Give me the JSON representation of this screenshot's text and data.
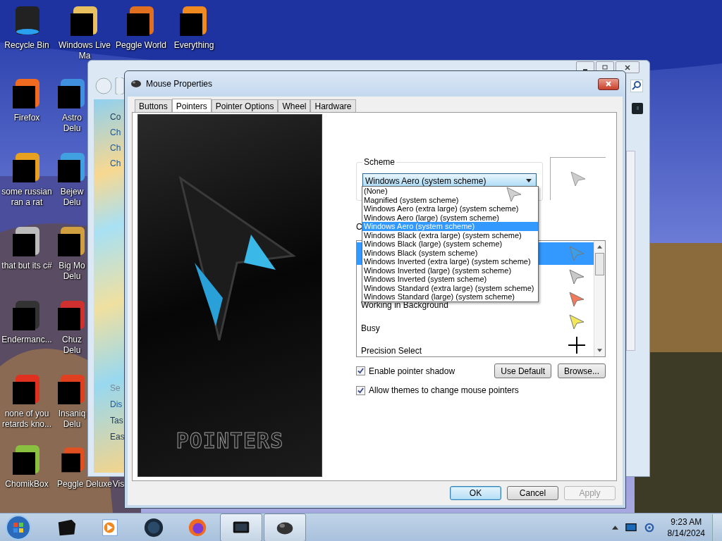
{
  "desktop_icons": [
    {
      "label": "Recycle Bin",
      "redacted": false
    },
    {
      "label": "Windows Live Ma",
      "redacted": true
    },
    {
      "label": "Peggle World",
      "redacted": true
    },
    {
      "label": "Everything",
      "redacted": true
    },
    {
      "label": "Firefox",
      "redacted": true
    },
    {
      "label": "Astro Delu",
      "redacted": true
    },
    {
      "label": "some russian ran a rat",
      "redacted": true
    },
    {
      "label": "Bejew Delu",
      "redacted": true
    },
    {
      "label": "that but its c#",
      "redacted": true
    },
    {
      "label": "Big Mo Delu",
      "redacted": true
    },
    {
      "label": "Endermanc...",
      "redacted": true
    },
    {
      "label": "Chuz Delu",
      "redacted": true
    },
    {
      "label": "none of you retards kno...",
      "redacted": true
    },
    {
      "label": "Insaniq Delu",
      "redacted": true
    },
    {
      "label": "ChomikBox",
      "redacted": true
    },
    {
      "label": "Peggle Deluxe",
      "redacted": true
    },
    {
      "label": "Vis"
    }
  ],
  "background_window": {
    "nav_links": [
      {
        "label": "Co",
        "kind": "heading"
      },
      {
        "label": "Ch",
        "kind": "link"
      },
      {
        "label": "Ch",
        "kind": "link"
      },
      {
        "label": "Ch",
        "kind": "link"
      }
    ],
    "see_also": {
      "title": "Se",
      "links": [
        "Dis",
        "Tas",
        "Eas"
      ]
    }
  },
  "dialog": {
    "title": "Mouse Properties",
    "tabs": [
      {
        "label": "Buttons",
        "selected": false
      },
      {
        "label": "Pointers",
        "selected": true
      },
      {
        "label": "Pointer Options",
        "selected": false
      },
      {
        "label": "Wheel",
        "selected": false
      },
      {
        "label": "Hardware",
        "selected": false
      }
    ],
    "preview_art": {
      "label": "POINTERS"
    },
    "scheme": {
      "label": "Scheme",
      "value": "Windows Aero (system scheme)",
      "expanded": true,
      "options": [
        {
          "label": "(None)",
          "selected": false
        },
        {
          "label": "Magnified (system scheme)",
          "selected": false
        },
        {
          "label": "Windows Aero (extra large) (system scheme)",
          "selected": false
        },
        {
          "label": "Windows Aero (large) (system scheme)",
          "selected": false
        },
        {
          "label": "Windows Aero (system scheme)",
          "selected": true
        },
        {
          "label": "Windows Black (extra large) (system scheme)",
          "selected": false
        },
        {
          "label": "Windows Black (large) (system scheme)",
          "selected": false
        },
        {
          "label": "Windows Black (system scheme)",
          "selected": false
        },
        {
          "label": "Windows Inverted (extra large) (system scheme)",
          "selected": false
        },
        {
          "label": "Windows Inverted (large) (system scheme)",
          "selected": false
        },
        {
          "label": "Windows Inverted (system scheme)",
          "selected": false
        },
        {
          "label": "Windows Standard (extra large) (system scheme)",
          "selected": false
        },
        {
          "label": "Windows Standard (large) (system scheme)",
          "selected": false
        }
      ]
    },
    "customize_label": "C",
    "pointers": [
      {
        "kind": "arrow",
        "color": "#3d9ee8",
        "selected": true
      },
      {
        "kind": "arrow",
        "color": "#c8c8c8",
        "selected": false
      },
      {
        "label": "Working in Background",
        "kind": "arrow",
        "color": "#f07a5a",
        "selected": false
      },
      {
        "label": "Busy",
        "kind": "arrow",
        "color": "#f2e65a",
        "selected": false
      },
      {
        "label": "Precision Select",
        "kind": "crosshair",
        "color": "#000000",
        "selected": false
      }
    ],
    "checkboxes": [
      {
        "label": "Enable pointer shadow",
        "checked": true
      },
      {
        "label": "Allow themes to change mouse pointers",
        "checked": true
      }
    ],
    "side_buttons": [
      "Use Default",
      "Browse..."
    ],
    "buttons": [
      {
        "label": "OK",
        "kind": "default",
        "disabled": false
      },
      {
        "label": "Cancel",
        "kind": "normal",
        "disabled": false
      },
      {
        "label": "Apply",
        "kind": "normal",
        "disabled": true
      }
    ]
  },
  "taskbar": {
    "items": [
      {
        "kind": "box",
        "selected": false
      },
      {
        "kind": "media",
        "selected": false
      },
      {
        "kind": "globe",
        "selected": false
      },
      {
        "kind": "fox",
        "selected": false
      },
      {
        "kind": "monitor",
        "selected": true
      },
      {
        "kind": "mouse",
        "selected": true
      }
    ],
    "clock": {
      "time": "9:23 AM",
      "date": "8/14/2024"
    }
  }
}
